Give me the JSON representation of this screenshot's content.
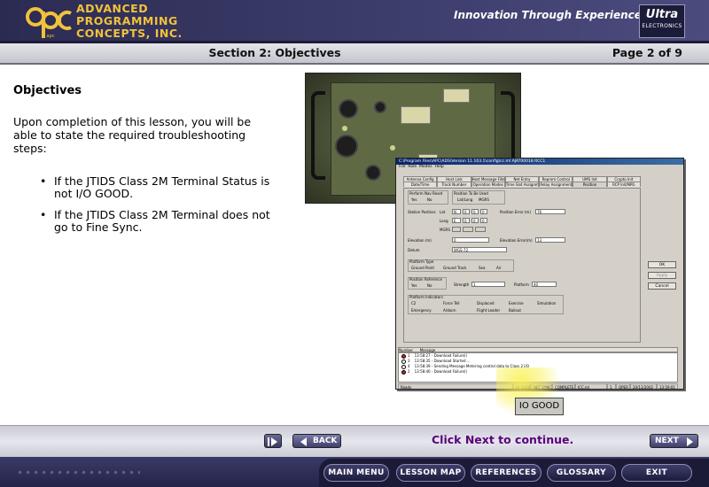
{
  "header": {
    "company_line1": "ADVANCED",
    "company_line2": "PROGRAMMING",
    "company_line3": "CONCEPTS, INC.",
    "logo_letters": "apc",
    "tagline": "Innovation Through Experience",
    "partner_logo_main": "Ultra",
    "partner_logo_sub": "ELECTRONICS"
  },
  "section_bar": {
    "title": "Section 2: Objectives",
    "page": "Page 2 of 9"
  },
  "content": {
    "heading": "Objectives",
    "intro": "Upon completion of this lesson, you will be able to state the required troubleshooting steps:",
    "bullets": [
      "If the JTIDS Class 2M Terminal Status is not I/O GOOD.",
      "If the JTIDS Class 2M Terminal does not go to Fine Sync."
    ]
  },
  "screenshot": {
    "title": "C:\\Program Files\\APC\\ADS\\Version 11.103.1\\config\\cc.ml    AJAT00018 RCC1",
    "menu": [
      "File",
      "Role",
      "Modes",
      "Help"
    ],
    "tabs_top": [
      "Antenna Config",
      "Host Link",
      "Host Message Filter",
      "Net Entry",
      "Reprom Control",
      "UMS Init",
      "Crypto Init"
    ],
    "tabs_bottom": [
      "Date/Time",
      "Track Number",
      "Operation Modes",
      "Time Slot Assignment",
      "Relay Assignment",
      "Position",
      "RCP Init/NPG"
    ],
    "side_buttons": [
      "OK",
      "Apply",
      "Cancel"
    ],
    "form": {
      "nav_reset_label": "Perform Nav Reset",
      "nav_reset_options": [
        "Yes",
        "No"
      ],
      "position_used_label": "Position To Be Used",
      "position_used_options": [
        "Lat/Long",
        "MGRS"
      ],
      "station_position_label": "Station Position:",
      "lat_label": "Lat",
      "lat_values": [
        "N",
        "0",
        "0",
        "0"
      ],
      "long_label": "Long",
      "long_values": [
        "E",
        "0",
        "0",
        "0"
      ],
      "mgrs_label": "MGRS",
      "position_error_label": "Position Error (m)",
      "position_error_value": "76",
      "elevation_label": "Elevation (m)",
      "elevation_value": "0",
      "elevation_error_label": "Elevation Error(m)",
      "elevation_error_value": "13",
      "datum_label": "Datum",
      "datum_value": "WGS-72",
      "platform_type_label": "Platform Type",
      "platform_type_options": [
        "Ground Point",
        "Ground Track",
        "Sea",
        "Air"
      ],
      "position_reference_label": "Position Reference",
      "position_reference_options": [
        "Yes",
        "No"
      ],
      "strength_label": "Strength",
      "strength_value": "1",
      "platform_label": "Platform",
      "platform_value": "40",
      "platform_indicators_label": "Platform Indicators",
      "indicators_row1": [
        "C2",
        "Force Tell",
        "Displaced",
        "Exercise",
        "Simulation"
      ],
      "indicators_row2": [
        "Emergency",
        "Airborn",
        "Flight Leader",
        "Bailout"
      ]
    },
    "log_headers": [
      "Number",
      "Message"
    ],
    "log_rows": [
      {
        "num": "1",
        "msg": "13:58:27 - Download Failure()",
        "color": "#d42020"
      },
      {
        "num": "3",
        "msg": "13:58:35 - Download Started ...",
        "color": "#ffffff"
      },
      {
        "num": "4",
        "msg": "13:58:39 - Sending Message Metering control data to Class 2 I/O",
        "color": "#ffffff"
      },
      {
        "num": "2",
        "msg": "13:58:40 - Download Failure()",
        "color": "#d42020"
      }
    ],
    "status_bar": [
      "Ready",
      "IO GOOD",
      "NET SYNC",
      "COMPLETE",
      "ICC.ml",
      "1",
      "OPER",
      "20/11/2002",
      "13:59:01"
    ]
  },
  "callout": {
    "text": "IO GOOD",
    "highlight_color": "#f6ee4a"
  },
  "nav": {
    "back_label": "BACK",
    "continue_text": "Click Next to continue.",
    "next_label": "NEXT"
  },
  "footer_menu": [
    "MAIN MENU",
    "LESSON MAP",
    "REFERENCES",
    "GLOSSARY",
    "EXIT"
  ],
  "colors": {
    "header_bg": "#3a3a68",
    "company_text": "#f2c23a",
    "continue_text": "#5a007a",
    "footer_bg": "#24244a"
  }
}
